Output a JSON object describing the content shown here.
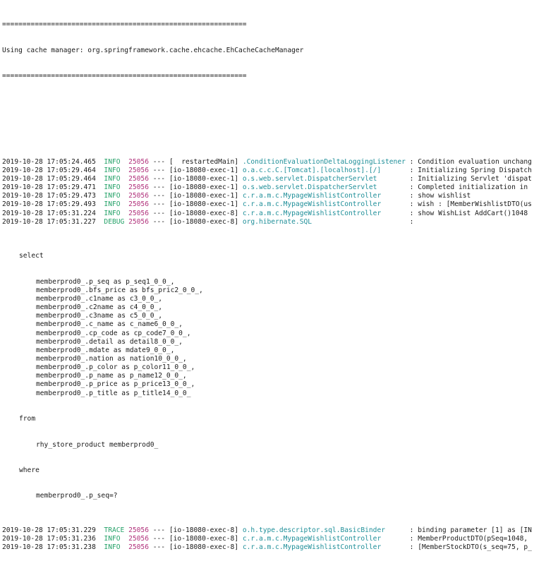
{
  "header": {
    "rule": "============================================================",
    "message": "Using cache manager: org.springframework.cache.ehcache.EhCacheCacheManager"
  },
  "colors": {
    "level": "#26a269",
    "pid": "#b0307a",
    "logger": "#1f8f99",
    "text": "#1a1a1a",
    "background": "#ffffff"
  },
  "log_lines": [
    {
      "ts": "2019-10-28 17:05:24.465",
      "level": "INFO ",
      "pid": "25056",
      "thread": " --- [  restartedMain] ",
      "logger": ".ConditionEvaluationDeltaLoggingListener",
      "msg": " : Condition evaluation unchang"
    },
    {
      "ts": "2019-10-28 17:05:29.464",
      "level": "INFO ",
      "pid": "25056",
      "thread": " --- [io-18080-exec-1] ",
      "logger": "o.a.c.c.C.[Tomcat].[localhost].[/]      ",
      "msg": " : Initializing Spring Dispatch"
    },
    {
      "ts": "2019-10-28 17:05:29.464",
      "level": "INFO ",
      "pid": "25056",
      "thread": " --- [io-18080-exec-1] ",
      "logger": "o.s.web.servlet.DispatcherServlet       ",
      "msg": " : Initializing Servlet 'dispat"
    },
    {
      "ts": "2019-10-28 17:05:29.471",
      "level": "INFO ",
      "pid": "25056",
      "thread": " --- [io-18080-exec-1] ",
      "logger": "o.s.web.servlet.DispatcherServlet       ",
      "msg": " : Completed initialization in "
    },
    {
      "ts": "2019-10-28 17:05:29.473",
      "level": "INFO ",
      "pid": "25056",
      "thread": " --- [io-18080-exec-1] ",
      "logger": "c.r.a.m.c.MypageWishlistController      ",
      "msg": " : show wishlist"
    },
    {
      "ts": "2019-10-28 17:05:29.493",
      "level": "INFO ",
      "pid": "25056",
      "thread": " --- [io-18080-exec-1] ",
      "logger": "c.r.a.m.c.MypageWishlistController      ",
      "msg": " : wish : [MemberWishlistDTO(us"
    },
    {
      "ts": "2019-10-28 17:05:31.224",
      "level": "INFO ",
      "pid": "25056",
      "thread": " --- [io-18080-exec-8] ",
      "logger": "c.r.a.m.c.MypageWishlistController      ",
      "msg": " : show WishList AddCart()1048"
    },
    {
      "ts": "2019-10-28 17:05:31.227",
      "level": "DEBUG",
      "pid": "25056",
      "thread": " --- [io-18080-exec-8] ",
      "logger": "org.hibernate.SQL                       ",
      "msg": " :"
    }
  ],
  "sql": {
    "select_kw": "select",
    "columns": [
      "memberprod0_.p_seq as p_seq1_0_0_,",
      "memberprod0_.bfs_price as bfs_pric2_0_0_,",
      "memberprod0_.c1name as c3_0_0_,",
      "memberprod0_.c2name as c4_0_0_,",
      "memberprod0_.c3name as c5_0_0_,",
      "memberprod0_.c_name as c_name6_0_0_,",
      "memberprod0_.cp_code as cp_code7_0_0_,",
      "memberprod0_.detail as detail8_0_0_,",
      "memberprod0_.mdate as mdate9_0_0_,",
      "memberprod0_.nation as nation10_0_0_,",
      "memberprod0_.p_color as p_color11_0_0_,",
      "memberprod0_.p_name as p_name12_0_0_,",
      "memberprod0_.p_price as p_price13_0_0_,",
      "memberprod0_.p_title as p_title14_0_0_"
    ],
    "from_kw": "from",
    "table": "rhy_store_product memberprod0_",
    "where_kw": "where",
    "condition": "memberprod0_.p_seq=?"
  },
  "tail_lines": [
    {
      "ts": "2019-10-28 17:05:31.229",
      "level": "TRACE",
      "pid": "25056",
      "thread": " --- [io-18080-exec-8] ",
      "logger": "o.h.type.descriptor.sql.BasicBinder     ",
      "msg": " : binding parameter [1] as [IN"
    },
    {
      "ts": "2019-10-28 17:05:31.236",
      "level": "INFO ",
      "pid": "25056",
      "thread": " --- [io-18080-exec-8] ",
      "logger": "c.r.a.m.c.MypageWishlistController      ",
      "msg": " : MemberProductDTO(pSeq=1048, "
    },
    {
      "ts": "2019-10-28 17:05:31.238",
      "level": "INFO ",
      "pid": "25056",
      "thread": " --- [io-18080-exec-8] ",
      "logger": "c.r.a.m.c.MypageWishlistController      ",
      "msg": " : [MemberStockDTO(s_seq=75, p_"
    }
  ]
}
